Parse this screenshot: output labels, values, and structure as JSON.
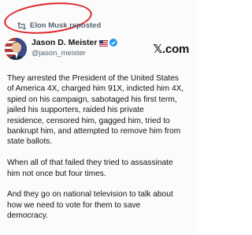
{
  "repost": {
    "icon": "repost-icon",
    "text": "Elon Musk reposted"
  },
  "author": {
    "name": "Jason D. Meister",
    "flag": "us-flag-icon",
    "verified_color": "#1d9bf0",
    "handle": "@jason_meister"
  },
  "brand": {
    "logo_text": "𝕏.com"
  },
  "post": {
    "paragraphs": [
      "They arrested the President of the United States\nof America 4X, charged him 91X, indicted him 4X,\nspied on his campaign, sabotaged his first term,\njailed his supporters, raided his private\nresidence, censored him, gagged him, tried to\nbankrupt him, and attempted to remove him from\nstate ballots.",
      "When all of that failed they tried to assassinate\nhim not once but four times.",
      "And they go on national television to talk about\nhow we need to vote for them to save\ndemocracy."
    ]
  },
  "colors": {
    "highlight_circle": "#e0242a",
    "secondary_text": "#536471"
  }
}
